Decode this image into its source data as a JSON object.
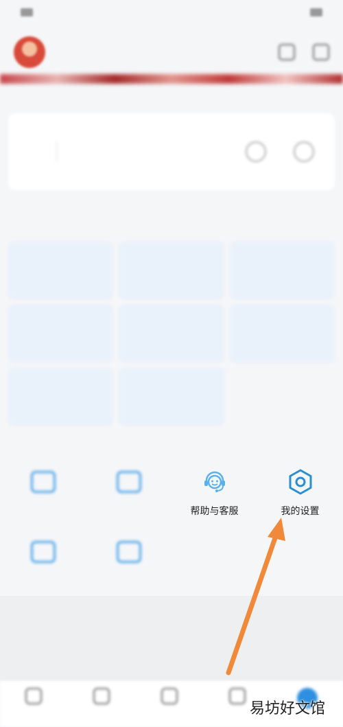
{
  "status_bar": {
    "left": "",
    "right": ""
  },
  "header": {
    "phone": ""
  },
  "stats": [
    {
      "label": "",
      "value": ""
    },
    {
      "label": "",
      "value": ""
    }
  ],
  "sections": {
    "common_services": "",
    "personal_services": ""
  },
  "tiles": [
    {
      "title": "",
      "subtitle": ""
    },
    {
      "title": "",
      "subtitle": ""
    },
    {
      "title": "",
      "subtitle": ""
    },
    {
      "title": "",
      "subtitle": ""
    },
    {
      "title": "",
      "subtitle": ""
    },
    {
      "title": "",
      "subtitle": ""
    },
    {
      "title": "",
      "subtitle": ""
    },
    {
      "title": "",
      "subtitle": ""
    }
  ],
  "services": [
    {
      "label": "",
      "icon": "box-icon"
    },
    {
      "label": "",
      "icon": "box-icon"
    },
    {
      "label": "帮助与客服",
      "icon": "headset-icon"
    },
    {
      "label": "我的设置",
      "icon": "hexagon-settings-icon"
    },
    {
      "label": "",
      "icon": "box-icon"
    },
    {
      "label": "",
      "icon": "box-icon"
    }
  ],
  "footer_note": "",
  "tabs": [
    {
      "label": ""
    },
    {
      "label": ""
    },
    {
      "label": ""
    },
    {
      "label": ""
    },
    {
      "label": ""
    }
  ],
  "colors": {
    "accent": "#2d8fe0",
    "settings_icon": "#2a8fd0",
    "arrow": "#f08a3a"
  },
  "watermark": "易坊好文馆"
}
